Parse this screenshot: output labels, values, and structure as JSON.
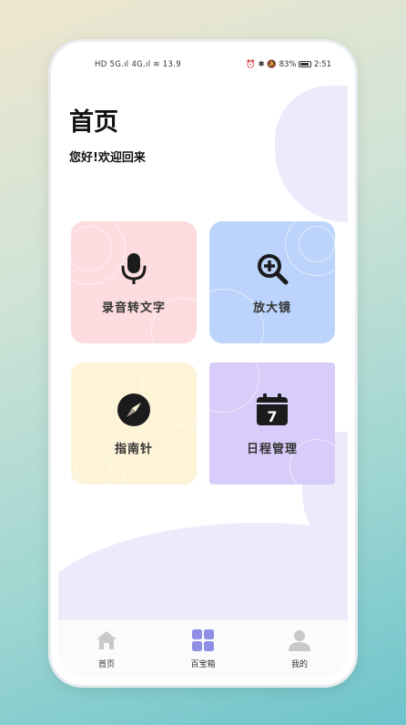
{
  "status_bar": {
    "left": "HD 5G.ıl 4G.ıl ≋ 13.9",
    "right": "83%",
    "time": "2:51"
  },
  "header": {
    "title": "首页",
    "subtitle": "您好!欢迎回来"
  },
  "tools": [
    {
      "label": "录音转文字",
      "icon": "microphone-icon"
    },
    {
      "label": "放大镜",
      "icon": "magnifier-plus-icon"
    },
    {
      "label": "指南针",
      "icon": "compass-icon"
    },
    {
      "label": "日程管理",
      "icon": "calendar-icon",
      "icon_text": "7"
    }
  ],
  "tabbar": {
    "items": [
      {
        "label": "首页",
        "icon": "home-icon"
      },
      {
        "label": "百宝箱",
        "icon": "grid-icon",
        "active": true
      },
      {
        "label": "我的",
        "icon": "profile-icon"
      }
    ]
  },
  "colors": {
    "tile_pink": "#fcdcdf",
    "tile_blue": "#bcd4fb",
    "tile_yellow": "#fdf3d7",
    "tile_purple": "#d8ccfa",
    "active_tab": "#8f8fe6",
    "inactive_tab": "#c9c9c9"
  }
}
